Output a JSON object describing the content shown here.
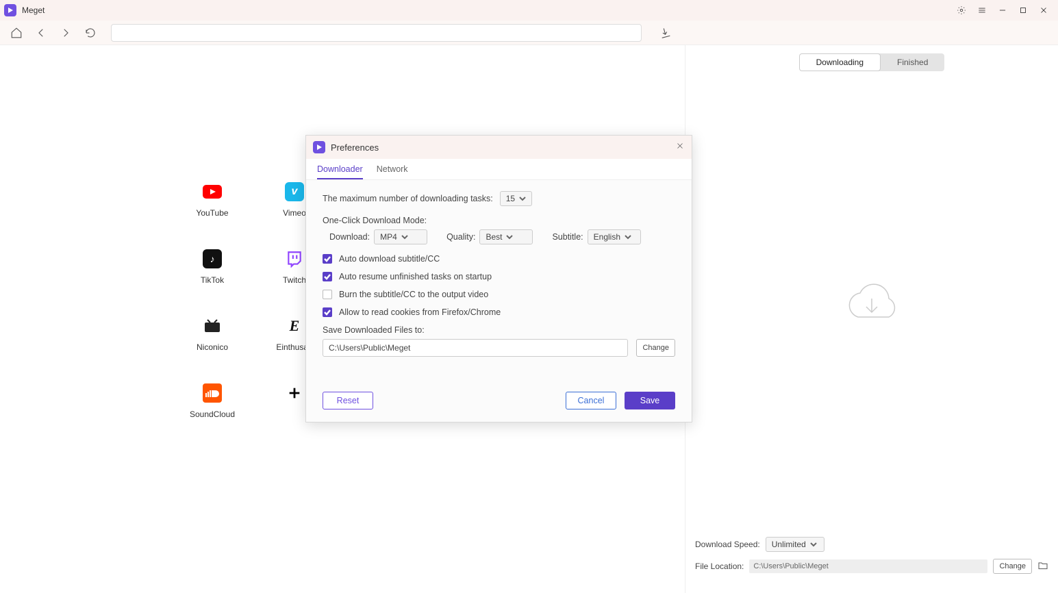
{
  "app": {
    "title": "Meget"
  },
  "window_controls": {
    "settings": "gear",
    "menu": "menu",
    "min": "minimize",
    "max": "maximize",
    "close": "close"
  },
  "nav": {
    "home": "home",
    "back": "back",
    "forward": "forward",
    "reload": "reload",
    "download": "download",
    "address": ""
  },
  "sites": [
    {
      "name": "YouTube",
      "icon": "youtube",
      "color": "#ff0000"
    },
    {
      "name": "Vimeo",
      "icon": "vimeo",
      "color": "#1ab7ea"
    },
    {
      "name": "TikTok",
      "icon": "tiktok",
      "color": "#111111"
    },
    {
      "name": "Twitch",
      "icon": "twitch",
      "color": "#9146ff"
    },
    {
      "name": "Niconico",
      "icon": "niconico",
      "color": "#222222"
    },
    {
      "name": "Einthusan",
      "icon": "einthusan",
      "color": "#111111"
    },
    {
      "name": "SoundCloud",
      "icon": "soundcloud",
      "color": "#ff5500"
    },
    {
      "name": "",
      "icon": "plus",
      "color": "#000000"
    }
  ],
  "right": {
    "tabs": {
      "downloading": "Downloading",
      "finished": "Finished",
      "active": "downloading"
    },
    "speed_label": "Download Speed:",
    "speed_value": "Unlimited",
    "location_label": "File Location:",
    "location_value": "C:\\Users\\Public\\Meget",
    "change_label": "Change"
  },
  "prefs": {
    "title": "Preferences",
    "tabs": {
      "downloader": "Downloader",
      "network": "Network",
      "active": "downloader"
    },
    "max_tasks_label": "The maximum number of downloading tasks:",
    "max_tasks_value": "15",
    "oneclick_label": "One-Click Download Mode:",
    "download_label": "Download:",
    "download_value": "MP4",
    "quality_label": "Quality:",
    "quality_value": "Best",
    "subtitle_label": "Subtitle:",
    "subtitle_value": "English",
    "chk_auto_sub": "Auto download subtitle/CC",
    "chk_auto_resume": "Auto resume unfinished tasks on startup",
    "chk_burn": "Burn the subtitle/CC to the output video",
    "chk_cookies": "Allow to read cookies from Firefox/Chrome",
    "chk_states": {
      "auto_sub": true,
      "auto_resume": true,
      "burn": false,
      "cookies": true
    },
    "save_label": "Save Downloaded Files to:",
    "save_value": "C:\\Users\\Public\\Meget",
    "change_label": "Change",
    "reset_label": "Reset",
    "cancel_label": "Cancel",
    "save_btn_label": "Save"
  }
}
